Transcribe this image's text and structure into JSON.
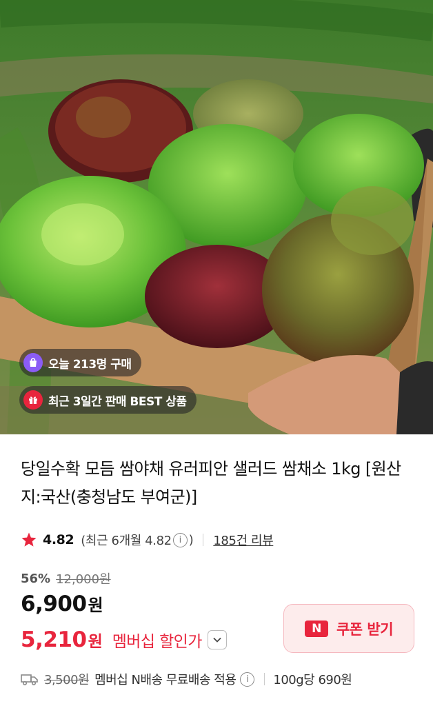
{
  "hero": {
    "badges": [
      {
        "text": "오늘 213명 구매",
        "icon": "shopping-bag-icon",
        "icon_color": "#8b5cf6"
      },
      {
        "text": "최근 3일간 판매 BEST 상품",
        "icon": "gift-icon",
        "icon_color": "#e8253d"
      }
    ]
  },
  "product": {
    "title": "당일수확 모듬 쌈야채 유러피안 샐러드 쌈채소 1kg [원산지:국산(충청남도 부여군)]",
    "rating": {
      "score": "4.82",
      "recent_text": "(최근 6개월 4.82",
      "recent_close": ")",
      "info_glyph": "i",
      "reviews": "185건 리뷰"
    },
    "discount_percent": "56%",
    "original_price": "12,000원",
    "price": "6,900",
    "price_unit": "원",
    "member_price": "5,210",
    "member_price_unit": "원",
    "member_label": "멤버십 할인가",
    "coupon": {
      "logo": "N",
      "label": "쿠폰 받기"
    },
    "shipping": {
      "fee": "3,500원",
      "text": "멤버십 N배송 무료배송 적용",
      "info_glyph": "i",
      "unit_price": "100g당 690원"
    }
  },
  "colors": {
    "accent_red": "#e8253d",
    "coupon_bg": "#fdecec"
  }
}
